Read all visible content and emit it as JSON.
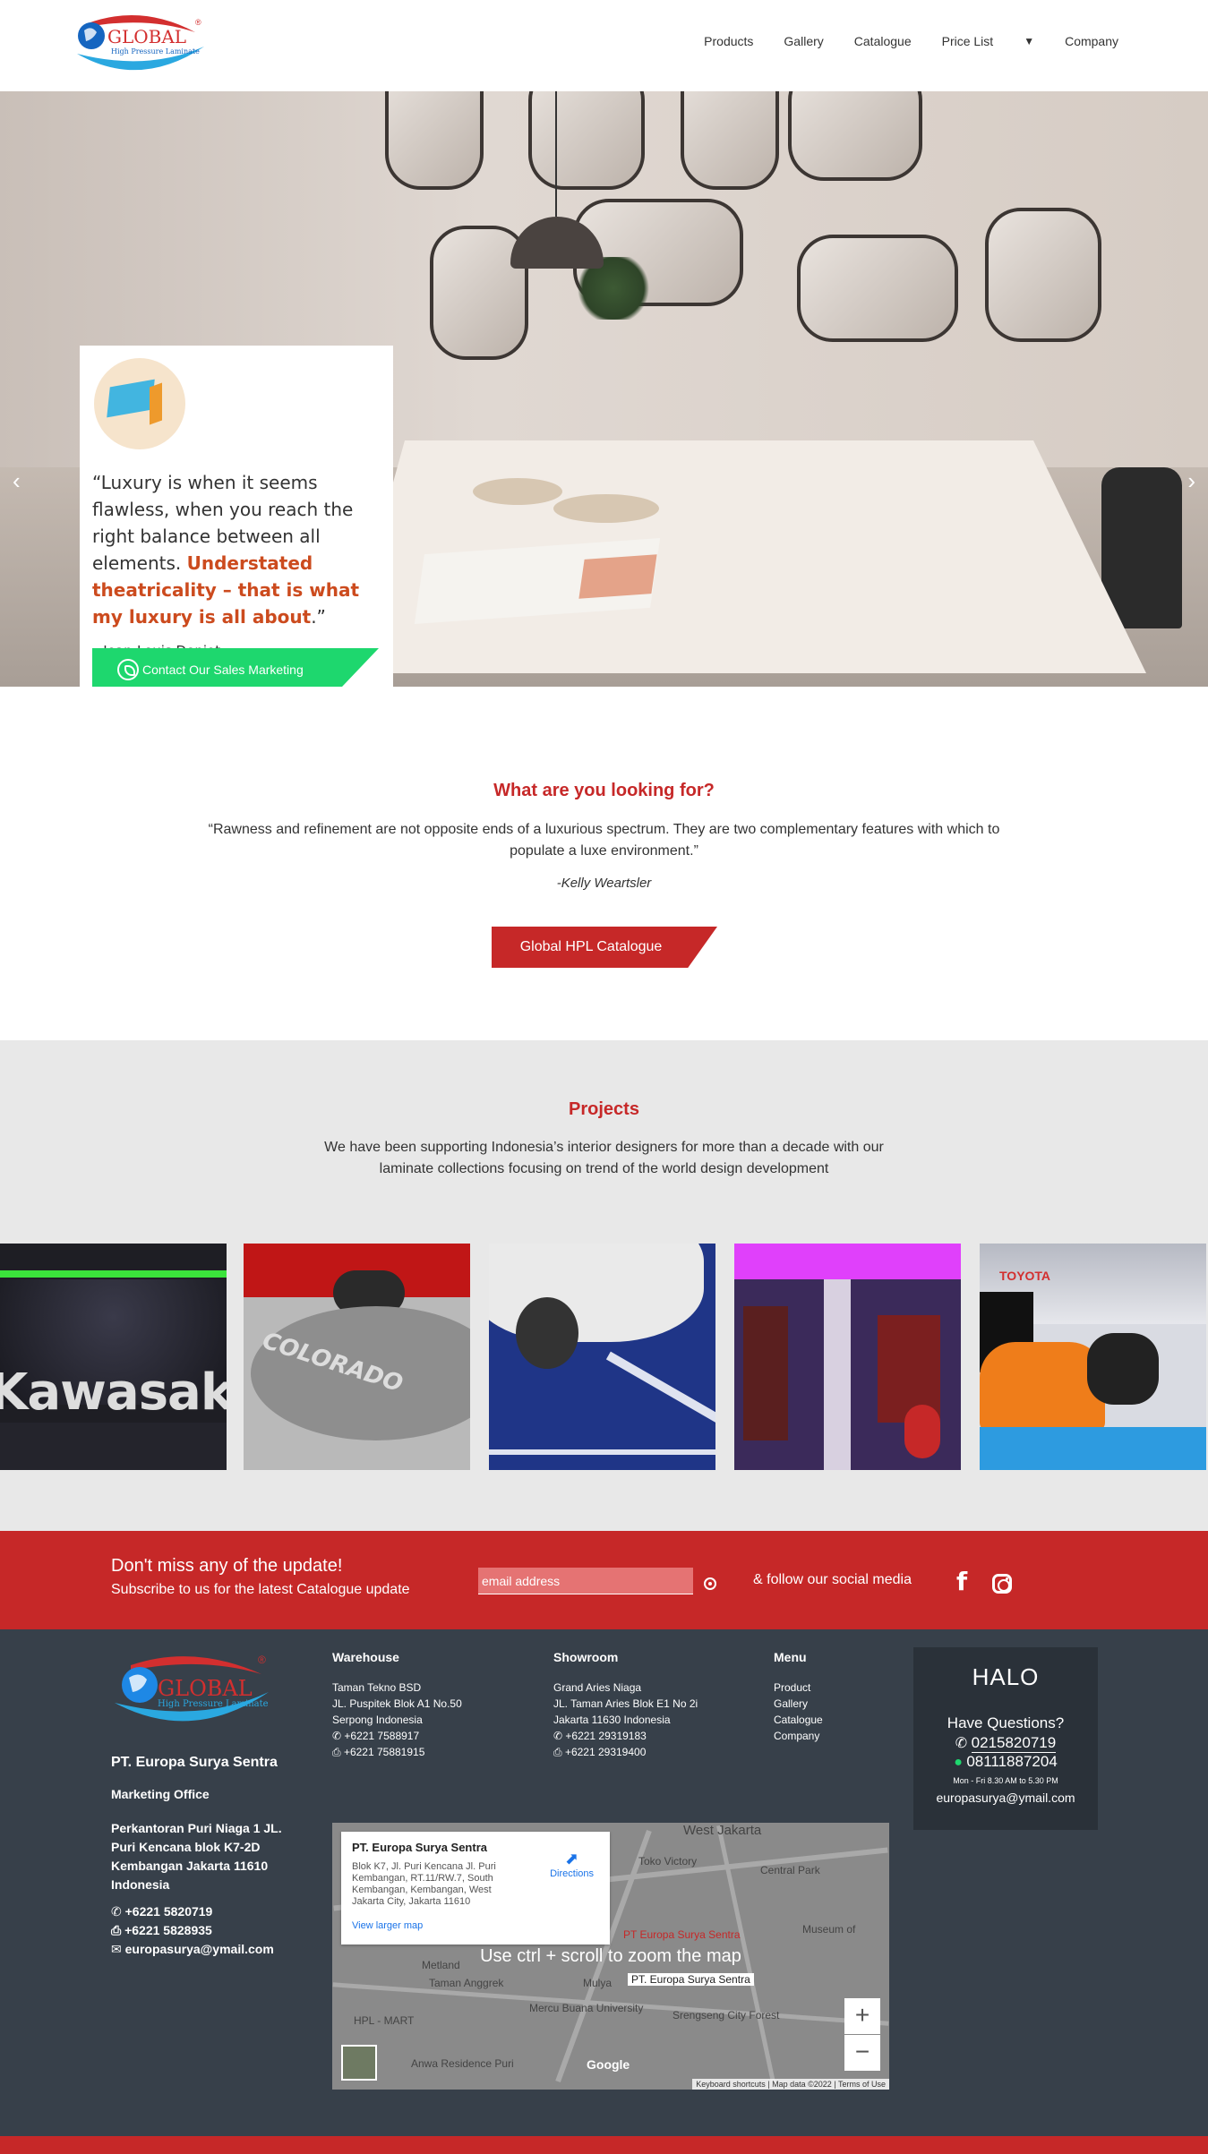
{
  "brand": {
    "logo_word": "GLOBAL",
    "logo_tagline": "High Pressure Laminate",
    "logo_reg": "®",
    "accent_red": "#c62828",
    "green": "#1ed76e",
    "footer_bg": "#37404a"
  },
  "nav": {
    "items": [
      "Products",
      "Gallery",
      "Catalogue",
      "Price List",
      "Company"
    ],
    "caret": "▼"
  },
  "hero": {
    "arrow_left": "‹",
    "arrow_right": "›",
    "quote_part1": "“Luxury is when it seems flawless, when you reach the right balance between all elements. ",
    "quote_highlight": "Understated theatricality – that is what my luxury is all about",
    "quote_end": ".”",
    "author": "– Jean-Louis Deniot –",
    "button": "Contact Our Sales Marketing"
  },
  "looking": {
    "title": "What are you looking for?",
    "quote": "“Rawness and refinement are not opposite ends of a luxurious spectrum. They are two complementary features with which to populate a luxe environment.”",
    "author": "-Kelly Weartsler",
    "button": "Global HPL Catalogue"
  },
  "projects": {
    "title": "Projects",
    "desc": "We have been supporting Indonesia’s interior designers for more than a decade with our laminate collections focusing on trend of the world design development",
    "images": [
      "Kawasaki",
      "COLORADO",
      "",
      "",
      "TOYOTA"
    ]
  },
  "newsletter": {
    "title": "Don't miss any of the update!",
    "subtitle": "Subscribe to us for the latest Catalogue update",
    "placeholder": "email address",
    "follow": "& follow our social media",
    "fb": "f"
  },
  "footer": {
    "company": "PT. Europa Surya Sentra",
    "office_label": "Marketing Office",
    "address": "Perkantoran Puri Niaga 1 JL. Puri Kencana blok K7-2D Kembangan Jakarta 11610 Indonesia",
    "phone": "+6221 5820719",
    "fax": "+6221 5828935",
    "email": "europasurya@ymail.com",
    "warehouse": {
      "title": "Warehouse",
      "lines": [
        "Taman Tekno BSD",
        "JL. Puspitek Blok A1 No.50",
        "Serpong Indonesia",
        "+6221 7588917",
        "+6221 75881915"
      ]
    },
    "showroom": {
      "title": "Showroom",
      "lines": [
        "Grand Aries Niaga",
        "JL. Taman Aries Blok E1 No 2i",
        "Jakarta 11630 Indonesia",
        "+6221 29319183",
        "+6221 29319400"
      ]
    },
    "menu": {
      "title": "Menu",
      "items": [
        "Product",
        "Gallery",
        "Catalogue",
        "Company"
      ]
    },
    "map": {
      "card_title": "PT. Europa Surya Sentra",
      "card_address": "Blok K7, Jl. Puri Kencana Jl. Puri Kembangan, RT.11/RW.7, South Kembangan, Kembangan, West Jakarta City, Jakarta 11610",
      "directions": "Directions",
      "larger": "View larger map",
      "hint": "Use ctrl + scroll to zoom the map",
      "labels": [
        "West Jakarta",
        "Toko Victory",
        "Central Park",
        "PT Europa Surya Sentra",
        "PT. Europa Surya Sentra",
        "Metland",
        "Taman Anggrek",
        "Mulya",
        "Mercu Buana University",
        "Srengseng City Forest",
        "HPL - MART",
        "Anwa Residence Puri",
        "Museum of"
      ],
      "zoom_in": "+",
      "zoom_out": "−",
      "footer": "Keyboard shortcuts | Map data ©2022 | Terms of Use",
      "google": "Google"
    },
    "halo": {
      "title": "HALO",
      "question": "Have Questions?",
      "phone1": "0215820719",
      "phone2": "08111887204",
      "hours": "Mon - Fri 8.30 AM to 5.30 PM",
      "email": "europasurya@ymail.com"
    }
  }
}
